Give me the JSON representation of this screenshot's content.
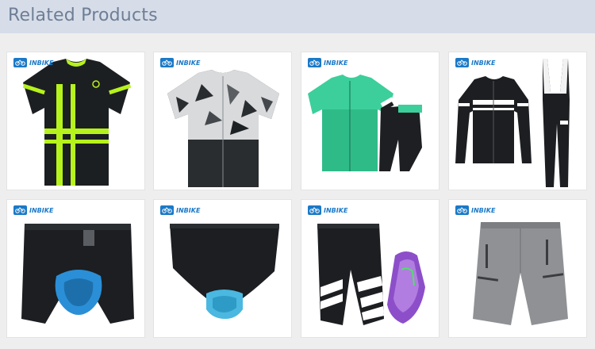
{
  "header": {
    "title": "Related Products"
  },
  "brand": {
    "name": "INBIKE"
  },
  "products": [
    {
      "type": "jersey",
      "colorway": "black-neon-green",
      "icon": "short-sleeve-jersey-icon"
    },
    {
      "type": "jersey",
      "colorway": "black-white-geometric",
      "icon": "short-sleeve-jersey-icon"
    },
    {
      "type": "jersey-and-shorts-set",
      "colorway": "mint-green-black",
      "icon": "jersey-shorts-set-icon"
    },
    {
      "type": "long-sleeve-jersey-and-bib-tights",
      "colorway": "black-white",
      "icon": "long-sleeve-set-icon"
    },
    {
      "type": "padded-underwear-shorts",
      "colorway": "black-blue-pad",
      "icon": "padded-shorts-icon"
    },
    {
      "type": "padded-briefs",
      "colorway": "black-blue-pad",
      "icon": "padded-briefs-icon"
    },
    {
      "type": "cycling-shorts-with-pad",
      "colorway": "black-white-purple-pad",
      "icon": "cycling-shorts-icon"
    },
    {
      "type": "baggy-mtb-shorts",
      "colorway": "grey",
      "icon": "baggy-shorts-icon"
    }
  ],
  "colors": {
    "header_bg": "#d6dde9",
    "header_text": "#6e7e95",
    "brand": "#1a79c8",
    "neon": "#b6f21c",
    "mint": "#3ccf9b",
    "pad_blue": "#2a8fd6",
    "pad_purple": "#8c4fc9"
  }
}
